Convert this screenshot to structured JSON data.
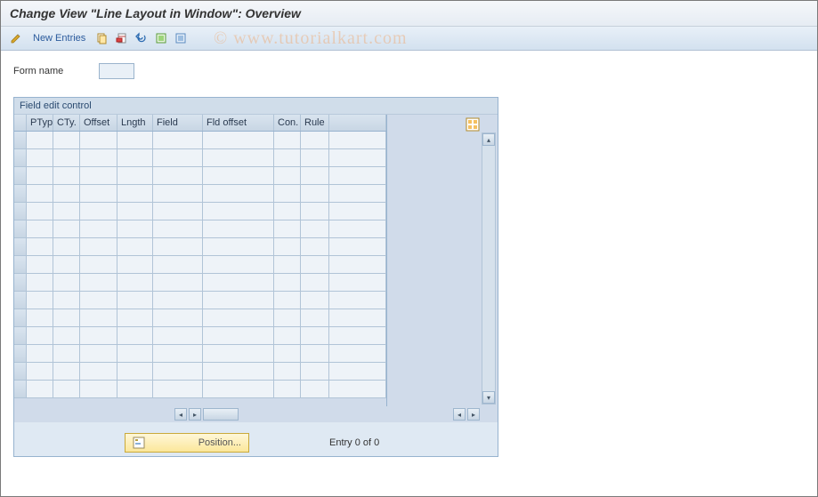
{
  "header": {
    "title": "Change View \"Line Layout in Window\": Overview"
  },
  "toolbar": {
    "new_entries_label": "New Entries"
  },
  "form": {
    "form_name_label": "Form name",
    "form_name_value": ""
  },
  "panel": {
    "title": "Field edit control"
  },
  "grid": {
    "columns": [
      {
        "key": "ptyp",
        "label": "PTyp"
      },
      {
        "key": "cty",
        "label": "CTy."
      },
      {
        "key": "offset",
        "label": "Offset"
      },
      {
        "key": "lngth",
        "label": "Lngth"
      },
      {
        "key": "field",
        "label": "Field"
      },
      {
        "key": "fldoffset",
        "label": "Fld offset"
      },
      {
        "key": "con",
        "label": "Con."
      },
      {
        "key": "rule",
        "label": "Rule"
      }
    ],
    "rows": 15
  },
  "footer": {
    "position_label": "Position...",
    "entry_text": "Entry 0 of 0"
  },
  "watermark": "© www.tutorialkart.com"
}
